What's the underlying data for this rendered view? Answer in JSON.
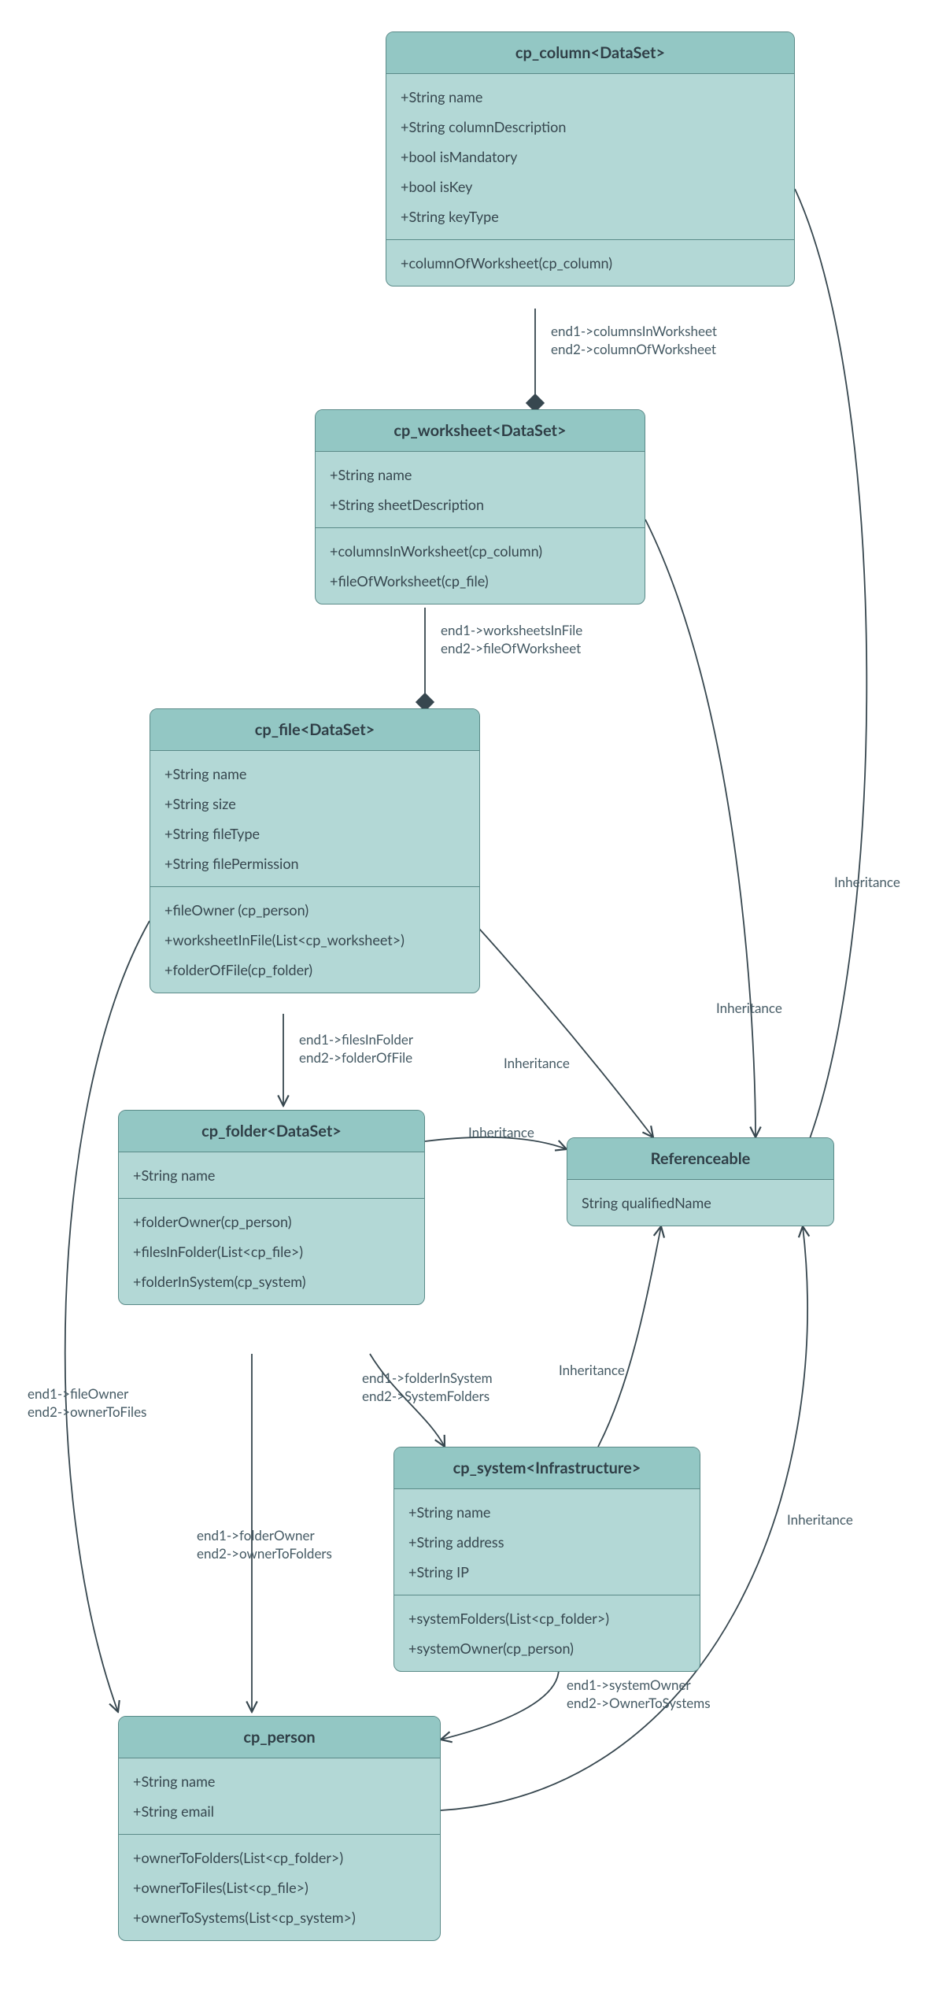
{
  "classes": {
    "cp_column": {
      "title": "cp_column<DataSet>",
      "attrs": [
        "+String name",
        "+String columnDescription",
        "+bool isMandatory",
        "+bool isKey",
        "+String keyType"
      ],
      "ops": [
        "+columnOfWorksheet(cp_column)"
      ]
    },
    "cp_worksheet": {
      "title": "cp_worksheet<DataSet>",
      "attrs": [
        "+String name",
        "+String  sheetDescription"
      ],
      "ops": [
        "+columnsInWorksheet(cp_column)",
        "+fileOfWorksheet(cp_file)"
      ]
    },
    "cp_file": {
      "title": "cp_file<DataSet>",
      "attrs": [
        "+String name",
        "+String size",
        "+String fileType",
        "+String filePermission"
      ],
      "ops": [
        "+fileOwner (cp_person)",
        "+worksheetInFile(List<cp_worksheet>)",
        "+folderOfFile(cp_folder)"
      ]
    },
    "cp_folder": {
      "title": "cp_folder<DataSet>",
      "attrs": [
        "+String name"
      ],
      "ops": [
        "+folderOwner(cp_person)",
        "+filesInFolder(List<cp_file>)",
        "+folderInSystem(cp_system)"
      ]
    },
    "cp_system": {
      "title": "cp_system<Infrastructure>",
      "attrs": [
        "+String name",
        "+String  address",
        "+String  IP"
      ],
      "ops": [
        "+systemFolders(List<cp_folder>)",
        "+systemOwner(cp_person)"
      ]
    },
    "cp_person": {
      "title": "cp_person",
      "attrs": [
        "+String name",
        "+String  email"
      ],
      "ops": [
        "+ownerToFolders(List<cp_folder>)",
        "+ownerToFiles(List<cp_file>)",
        "+ownerToSystems(List<cp_system>)"
      ]
    },
    "referenceable": {
      "title": "Referenceable",
      "attrs": [
        "String qualifiedName"
      ]
    }
  },
  "edge_labels": {
    "col_ws": {
      "l1": "end1->columnsInWorksheet",
      "l2": "end2->columnOfWorksheet"
    },
    "ws_file": {
      "l1": "end1->worksheetsInFile",
      "l2": "end2->fileOfWorksheet"
    },
    "file_fld": {
      "l1": "end1->filesInFolder",
      "l2": "end2->folderOfFile"
    },
    "fld_sys": {
      "l1": "end1->folderInSystem",
      "l2": "end2->SystemFolders"
    },
    "file_own": {
      "l1": "end1->fileOwner",
      "l2": "end2->ownerToFiles"
    },
    "fld_own": {
      "l1": "end1->folderOwner",
      "l2": "end2->ownerToFolders"
    },
    "sys_own": {
      "l1": "end1->systemOwner",
      "l2": "end2->OwnerToSystems"
    },
    "inh": "Inheritance"
  }
}
